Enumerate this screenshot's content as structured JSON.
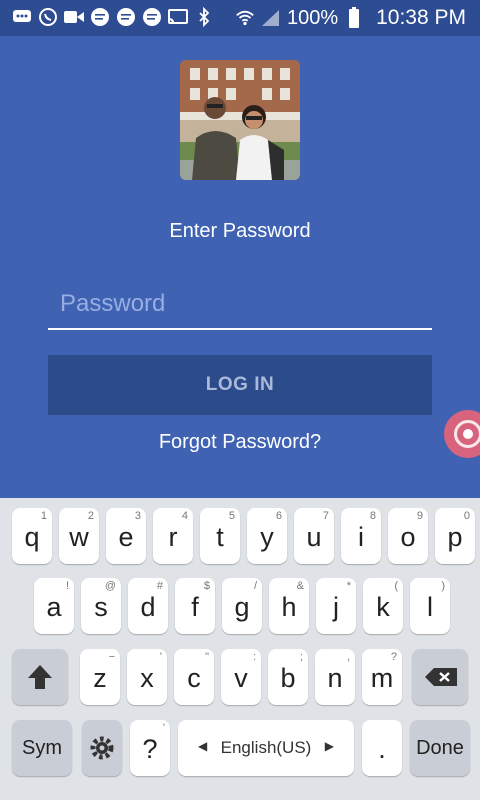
{
  "status_bar": {
    "battery": "100%",
    "time": "10:38 PM"
  },
  "login": {
    "prompt": "Enter Password",
    "password_placeholder": "Password",
    "login_label": "LOG IN",
    "forgot_label": "Forgot Password?"
  },
  "keyboard": {
    "row1": [
      {
        "k": "q",
        "s": "1"
      },
      {
        "k": "w",
        "s": "2"
      },
      {
        "k": "e",
        "s": "3"
      },
      {
        "k": "r",
        "s": "4"
      },
      {
        "k": "t",
        "s": "5"
      },
      {
        "k": "y",
        "s": "6"
      },
      {
        "k": "u",
        "s": "7"
      },
      {
        "k": "i",
        "s": "8"
      },
      {
        "k": "o",
        "s": "9"
      },
      {
        "k": "p",
        "s": "0"
      }
    ],
    "row2": [
      {
        "k": "a",
        "s": "!"
      },
      {
        "k": "s",
        "s": "@"
      },
      {
        "k": "d",
        "s": "#"
      },
      {
        "k": "f",
        "s": "$"
      },
      {
        "k": "g",
        "s": "/"
      },
      {
        "k": "h",
        "s": "&"
      },
      {
        "k": "j",
        "s": "*"
      },
      {
        "k": "k",
        "s": "("
      },
      {
        "k": "l",
        "s": ")"
      }
    ],
    "row3": [
      {
        "k": "z",
        "s": "−"
      },
      {
        "k": "x",
        "s": "'"
      },
      {
        "k": "c",
        "s": "\""
      },
      {
        "k": "v",
        "s": ":"
      },
      {
        "k": "b",
        "s": ";"
      },
      {
        "k": "n",
        "s": ","
      },
      {
        "k": "m",
        "s": "?"
      }
    ],
    "sym_label": "Sym",
    "question_key": "?",
    "question_sub": "'",
    "language_label": "English(US)",
    "period_key": ".",
    "done_label": "Done"
  }
}
